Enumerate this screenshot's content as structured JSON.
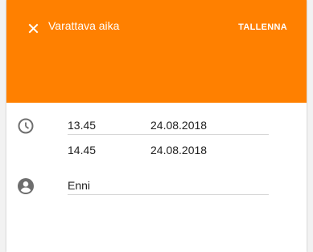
{
  "header": {
    "title": "Varattava aika",
    "save_label": "TALLENNA",
    "close_icon": "close-icon",
    "background_color": "#ff8000"
  },
  "start": {
    "icon": "clock-icon",
    "time": "13.45",
    "date": "24.08.2018"
  },
  "end": {
    "time": "14.45",
    "date": "24.08.2018"
  },
  "person": {
    "icon": "account-circle-icon",
    "name": "Enni"
  }
}
